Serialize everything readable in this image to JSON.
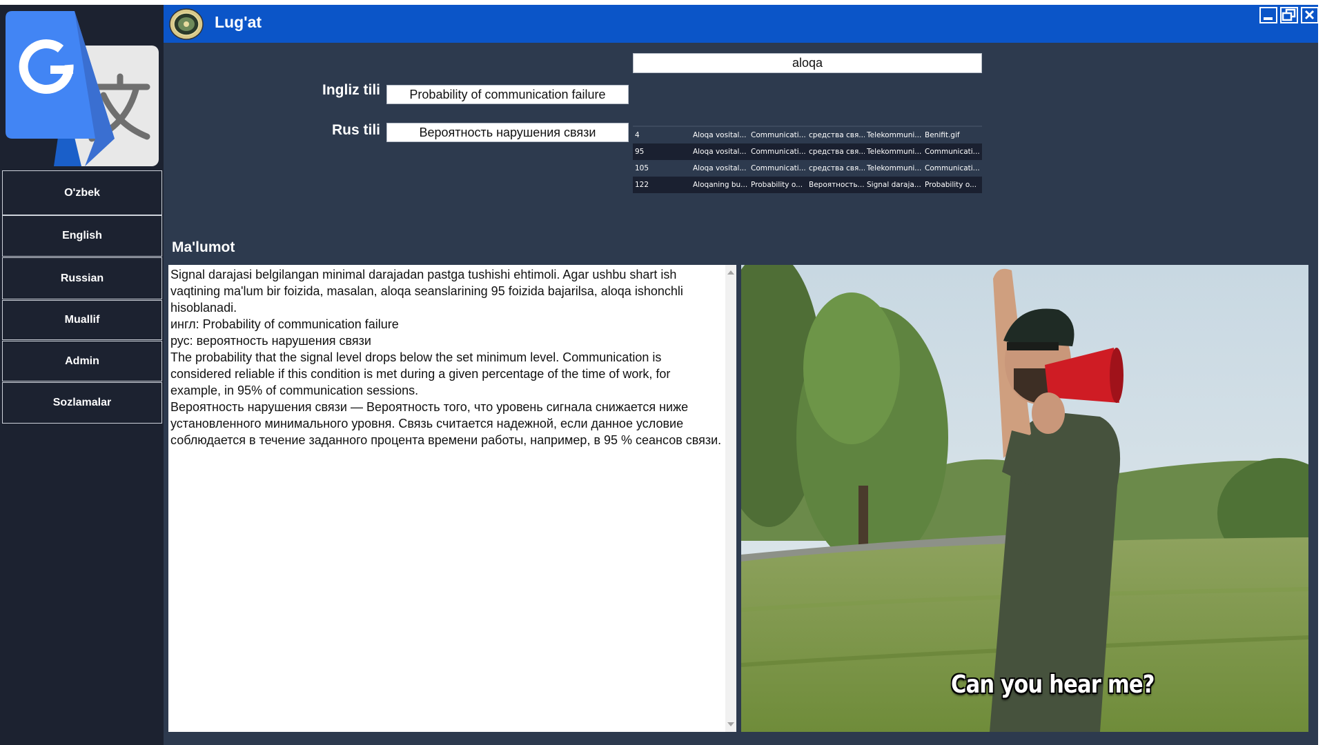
{
  "window": {
    "title": "Lug'at",
    "accent": "#0b55c8",
    "controls": {
      "minimize": "minimize-icon",
      "restore": "restore-icon",
      "close": "close-icon"
    }
  },
  "sidebar": {
    "logo": "google-translate-logo",
    "items": [
      {
        "label": "O'zbek"
      },
      {
        "label": "English"
      },
      {
        "label": "Russian"
      },
      {
        "label": "Muallif"
      },
      {
        "label": "Admin"
      },
      {
        "label": "Sozlamalar"
      }
    ]
  },
  "search": {
    "value": "aloqa"
  },
  "fields": {
    "english_label": "Ingliz tili",
    "english_value": "Probability of communication failure",
    "russian_label": "Rus tili",
    "russian_value": "Вероятность нарушения связи"
  },
  "results": {
    "rows": [
      [
        "4",
        "Aloqa vosital...",
        "Communicati...",
        "средства свя...",
        "Telekommuni...",
        "Benifit.gif"
      ],
      [
        "95",
        "Aloqa vosital...",
        "Communicati...",
        "средства свя...",
        "Telekommuni...",
        "Communicati..."
      ],
      [
        "105",
        "Aloqa vosital...",
        "Communicati...",
        "средства свя...",
        "Telekommuni...",
        "Communicati..."
      ],
      [
        "122",
        "Aloqaning bu...",
        "Probability o...",
        "Вероятность...",
        "Signal daraja...",
        "Probability o..."
      ]
    ]
  },
  "info": {
    "heading": "Ma'lumot",
    "text": "Signal darajasi belgilangan minimal darajadan pastga tushishi ehtimoli. Agar ushbu shart ish vaqtining ma'lum bir foizida, masalan, aloqa seanslarining 95 foizida bajarilsa, aloqa ishonchli hisoblanadi.\nингл: Probability of communication failure\nрус: вероятность нарушения связи\nThe probability that the signal level drops below the set minimum level. Communication is considered reliable if this condition is met during a given percentage of the time of work, for example, in 95% of communication sessions.\nВероятность нарушения связи — Вероятность того, что уровень сигнала снижается ниже установленного минимального уровня. Связь считается надежной, если данное условие соблюдается в течение заданного процента времени работы, например, в 95 % сеансов связи."
  },
  "media": {
    "caption": "Can you hear me?"
  }
}
